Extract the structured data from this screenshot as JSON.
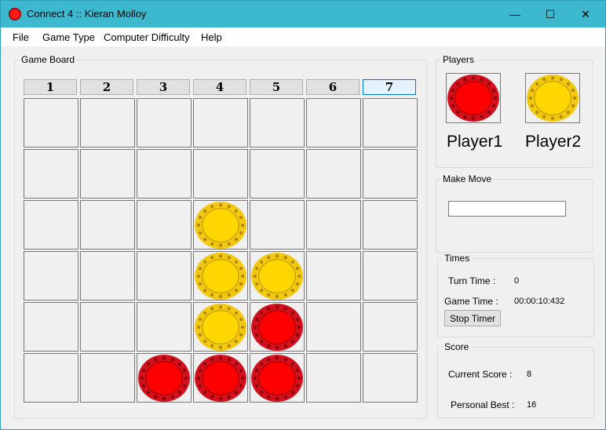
{
  "window": {
    "title": "Connect 4 :: Kieran Molloy",
    "controls": {
      "minimize": "—",
      "maximize": "☐",
      "close": "✕"
    }
  },
  "menu": [
    "File",
    "Game Type",
    "Computer Difficulty",
    "Help"
  ],
  "board": {
    "label": "Game Board",
    "columns": [
      "1",
      "2",
      "3",
      "4",
      "5",
      "6",
      "7"
    ],
    "active_column": "7",
    "grid": [
      [
        "",
        "",
        "",
        "",
        "",
        "",
        ""
      ],
      [
        "",
        "",
        "",
        "",
        "",
        "",
        ""
      ],
      [
        "",
        "",
        "",
        "yellow",
        "",
        "",
        ""
      ],
      [
        "",
        "",
        "",
        "yellow",
        "yellow",
        "",
        ""
      ],
      [
        "",
        "",
        "",
        "yellow",
        "red",
        "",
        ""
      ],
      [
        "",
        "",
        "red",
        "red",
        "red",
        "",
        ""
      ]
    ]
  },
  "players": {
    "label": "Players",
    "player1": {
      "name": "Player1",
      "color": "red"
    },
    "player2": {
      "name": "Player2",
      "color": "yellow"
    }
  },
  "make_move": {
    "label": "Make Move",
    "value": ""
  },
  "times": {
    "label": "Times",
    "turn_time_label": "Turn Time :",
    "turn_time_value": "0",
    "game_time_label": "Game Time :",
    "game_time_value": "00:00:10:432",
    "stop_timer": "Stop Timer"
  },
  "score": {
    "label": "Score",
    "current_label": "Current Score :",
    "current_value": "8",
    "best_label": "Personal Best :",
    "best_value": "16"
  },
  "colors": {
    "red": "#ff0000",
    "red_rim": "#d40f1e",
    "yellow": "#ffd700",
    "yellow_rim": "#f2c811",
    "titlebar": "#3cb9cf"
  }
}
